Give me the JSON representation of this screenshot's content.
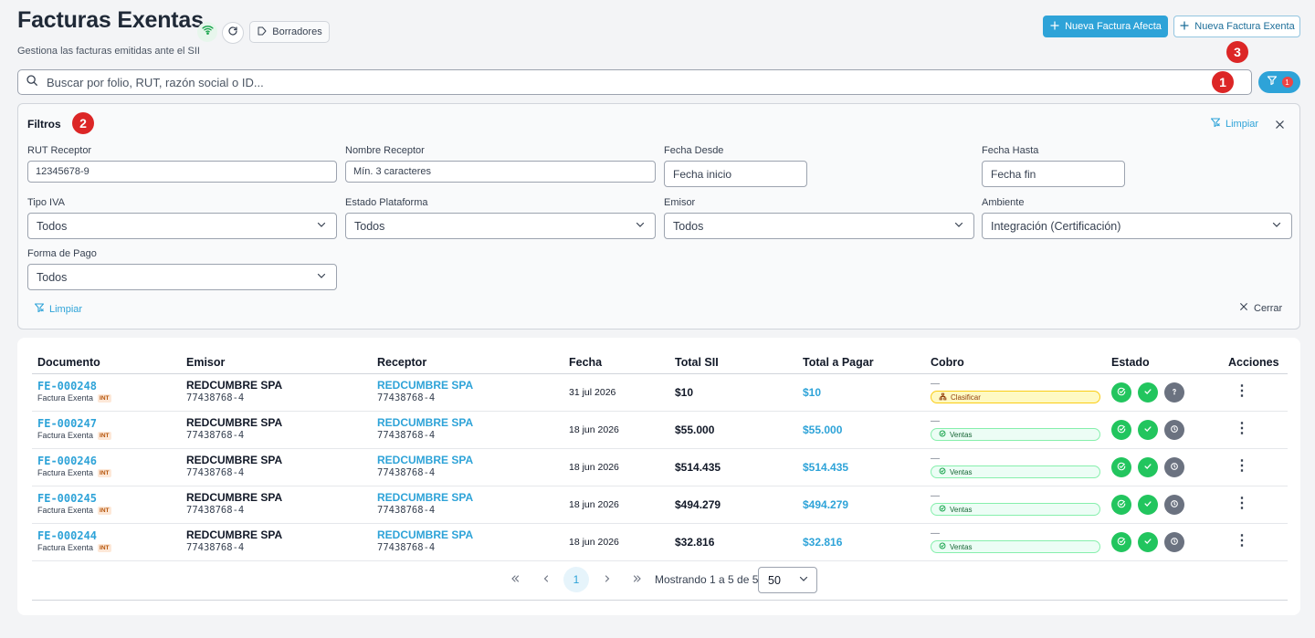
{
  "header": {
    "title": "Facturas Exentas",
    "subtitle": "Gestiona las facturas emitidas ante el SII",
    "drafts_label": "Borradores",
    "new_afecta_label": "Nueva Factura Afecta",
    "new_exenta_label": "Nueva Factura Exenta"
  },
  "annotations": {
    "a1": "1",
    "a2": "2",
    "a3": "3"
  },
  "search": {
    "placeholder": "Buscar por folio, RUT, razón social o ID...",
    "filter_count": "1"
  },
  "filters": {
    "title": "Filtros",
    "clear_label": "Limpiar",
    "close_label": "Cerrar",
    "rut_label": "RUT Receptor",
    "rut_value": "12345678-9",
    "nombre_label": "Nombre Receptor",
    "nombre_placeholder": "Mín. 3 caracteres",
    "fecha_desde_label": "Fecha Desde",
    "fecha_desde_placeholder": "Fecha inicio",
    "fecha_hasta_label": "Fecha Hasta",
    "fecha_hasta_placeholder": "Fecha fin",
    "tipo_iva_label": "Tipo IVA",
    "tipo_iva_value": "Todos",
    "estado_label": "Estado Plataforma",
    "estado_value": "Todos",
    "emisor_label": "Emisor",
    "emisor_value": "Todos",
    "ambiente_label": "Ambiente",
    "ambiente_value": "Integración (Certificación)",
    "forma_pago_label": "Forma de Pago",
    "forma_pago_value": "Todos"
  },
  "table": {
    "columns": [
      "Documento",
      "Emisor",
      "Receptor",
      "Fecha",
      "Total SII",
      "Total a Pagar",
      "Cobro",
      "Estado",
      "Acciones"
    ],
    "rows": [
      {
        "folio": "FE-000248",
        "doc_type": "Factura Exenta",
        "badge": "INT",
        "emisor": "REDCUMBRE SPA",
        "emisor_rut": "77438768-4",
        "receptor": "REDCUMBRE SPA",
        "receptor_rut": "77438768-4",
        "fecha": "31 jul 2026",
        "total_sii": "$10",
        "total_pagar": "$10",
        "cobro_dash": "—",
        "cobro": "Clasificar"
      },
      {
        "folio": "FE-000247",
        "doc_type": "Factura Exenta",
        "badge": "INT",
        "emisor": "REDCUMBRE SPA",
        "emisor_rut": "77438768-4",
        "receptor": "REDCUMBRE SPA",
        "receptor_rut": "77438768-4",
        "fecha": "18 jun 2026",
        "total_sii": "$55.000",
        "total_pagar": "$55.000",
        "cobro_dash": "—",
        "cobro": "Ventas"
      },
      {
        "folio": "FE-000246",
        "doc_type": "Factura Exenta",
        "badge": "INT",
        "emisor": "REDCUMBRE SPA",
        "emisor_rut": "77438768-4",
        "receptor": "REDCUMBRE SPA",
        "receptor_rut": "77438768-4",
        "fecha": "18 jun 2026",
        "total_sii": "$514.435",
        "total_pagar": "$514.435",
        "cobro_dash": "—",
        "cobro": "Ventas"
      },
      {
        "folio": "FE-000245",
        "doc_type": "Factura Exenta",
        "badge": "INT",
        "emisor": "REDCUMBRE SPA",
        "emisor_rut": "77438768-4",
        "receptor": "REDCUMBRE SPA",
        "receptor_rut": "77438768-4",
        "fecha": "18 jun 2026",
        "total_sii": "$494.279",
        "total_pagar": "$494.279",
        "cobro_dash": "—",
        "cobro": "Ventas"
      },
      {
        "folio": "FE-000244",
        "doc_type": "Factura Exenta",
        "badge": "INT",
        "emisor": "REDCUMBRE SPA",
        "emisor_rut": "77438768-4",
        "receptor": "REDCUMBRE SPA",
        "receptor_rut": "77438768-4",
        "fecha": "18 jun 2026",
        "total_sii": "$32.816",
        "total_pagar": "$32.816",
        "cobro_dash": "—",
        "cobro": "Ventas"
      }
    ]
  },
  "pagination": {
    "current_page": "1",
    "info": "Mostrando 1 a 5 de 5",
    "page_size": "50"
  },
  "colors": {
    "accent": "#2ea3d8",
    "success": "#22c55e",
    "neutral": "#6b7280",
    "annotation": "#dc2626"
  }
}
